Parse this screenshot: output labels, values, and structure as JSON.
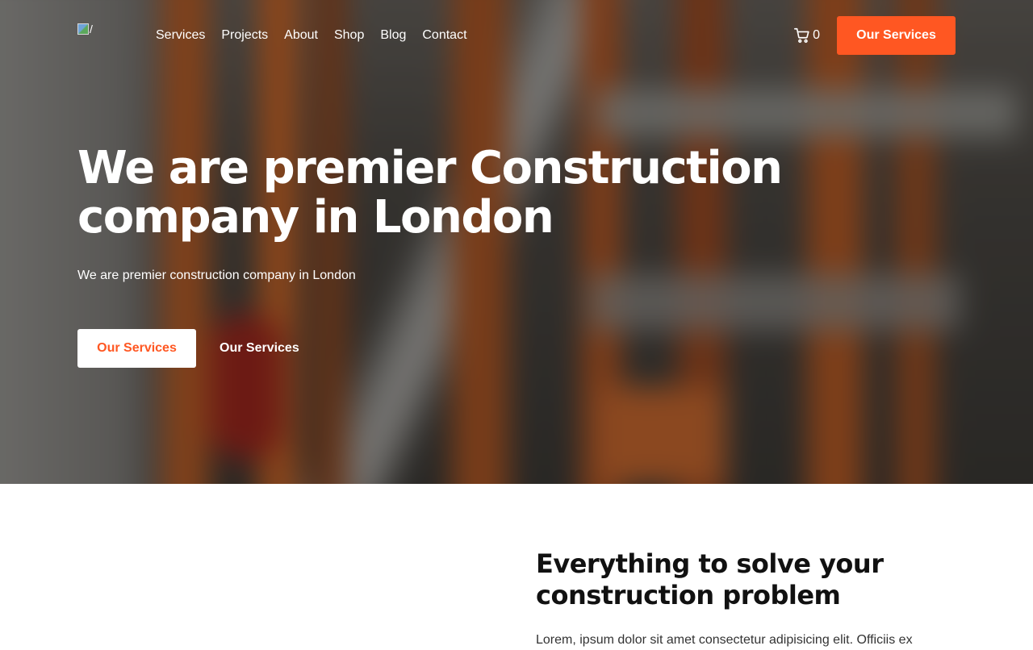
{
  "nav": {
    "links": [
      "Services",
      "Projects",
      "About",
      "Shop",
      "Blog",
      "Contact"
    ],
    "cart_count": "0",
    "cta_label": "Our Services"
  },
  "hero": {
    "title": "We are premier Construction company in London",
    "subtitle": "We are premier construction company in London",
    "primary_button": "Our Services",
    "secondary_button": "Our Services"
  },
  "section": {
    "title": "Everything to solve your construction problem",
    "body": "Lorem, ipsum dolor sit amet consectetur adipisicing elit. Officiis ex"
  },
  "colors": {
    "accent": "#ff5722",
    "text_dark": "#111111"
  },
  "icons": {
    "cart": "shopping-cart-icon",
    "logo": "broken-image-icon"
  }
}
